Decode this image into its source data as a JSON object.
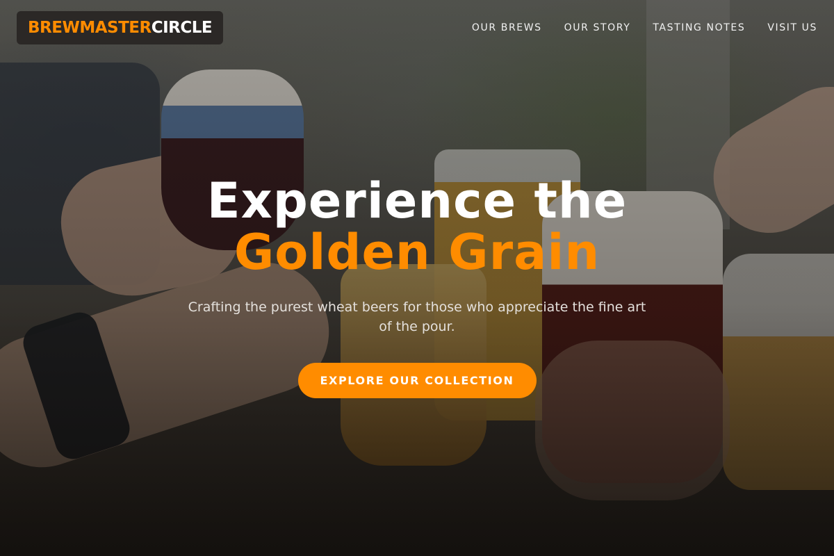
{
  "nav": {
    "logo_primary": "BREWMASTER",
    "logo_secondary": "CIRCLE",
    "links": [
      {
        "label": "OUR BREWS"
      },
      {
        "label": "OUR STORY"
      },
      {
        "label": "TASTING NOTES"
      },
      {
        "label": "VISIT US"
      }
    ]
  },
  "hero": {
    "title_line1": "Experience the",
    "title_line2": "Golden Grain",
    "subtitle": "Crafting the purest wheat beers for those who appreciate the fine art of the pour.",
    "cta_label": "EXPLORE OUR COLLECTION",
    "background_image": "friends-toasting-beer-glasses"
  },
  "colors": {
    "accent": "#ff8c00",
    "logo_bg": "#2b2826",
    "text_light": "#ffffff"
  }
}
